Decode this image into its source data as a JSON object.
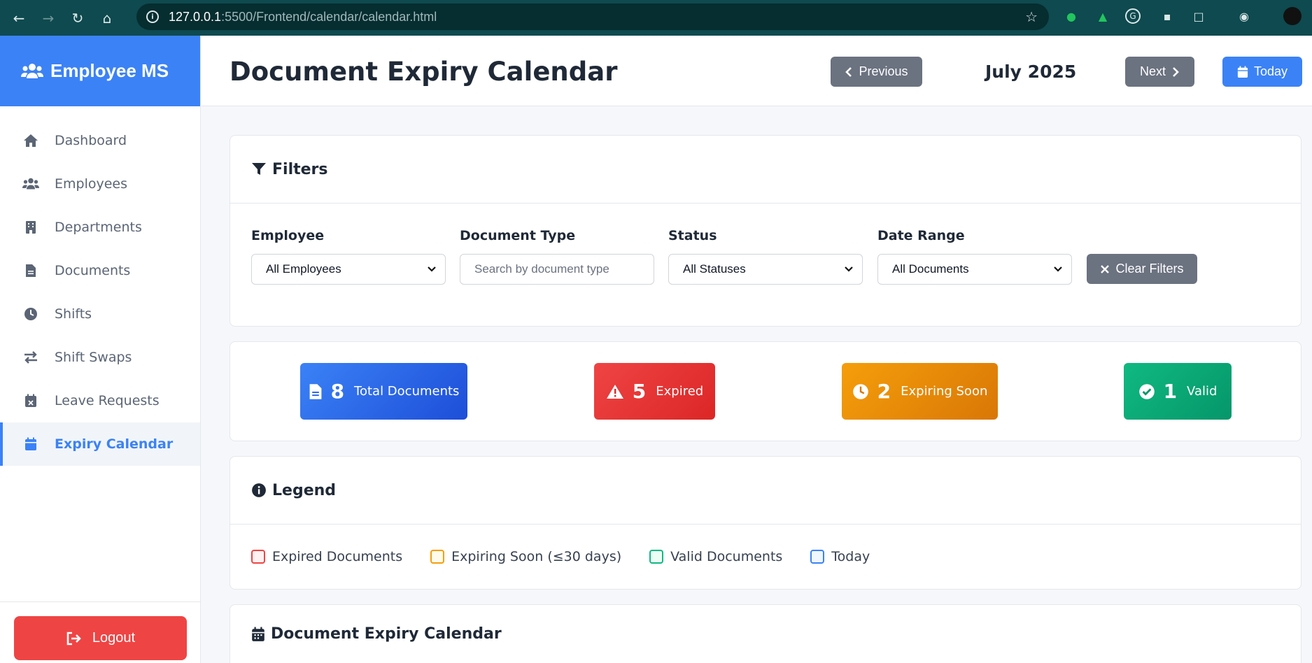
{
  "browser": {
    "url_host": "127.0.0.1",
    "url_rest": ":5500/Frontend/calendar/calendar.html"
  },
  "sidebar": {
    "brand": "Employee MS",
    "items": [
      {
        "label": "Dashboard",
        "icon": "home-icon"
      },
      {
        "label": "Employees",
        "icon": "users-icon"
      },
      {
        "label": "Departments",
        "icon": "building-icon"
      },
      {
        "label": "Documents",
        "icon": "file-icon"
      },
      {
        "label": "Shifts",
        "icon": "clock-icon"
      },
      {
        "label": "Shift Swaps",
        "icon": "swap-icon"
      },
      {
        "label": "Leave Requests",
        "icon": "calendar-x-icon"
      },
      {
        "label": "Expiry Calendar",
        "icon": "calendar-icon",
        "active": true
      }
    ],
    "logout_label": "Logout"
  },
  "header": {
    "title": "Document Expiry Calendar",
    "previous_label": "Previous",
    "month": "July 2025",
    "next_label": "Next",
    "today_label": "Today"
  },
  "filters": {
    "title": "Filters",
    "employee_label": "Employee",
    "employee_value": "All Employees",
    "doc_type_label": "Document Type",
    "doc_type_placeholder": "Search by document type",
    "status_label": "Status",
    "status_value": "All Statuses",
    "date_range_label": "Date Range",
    "date_range_value": "All Documents",
    "clear_label": "Clear Filters"
  },
  "stats": [
    {
      "value": "8",
      "label": "Total Documents",
      "color": "#2563eb"
    },
    {
      "value": "5",
      "label": "Expired",
      "color": "#dc2626"
    },
    {
      "value": "2",
      "label": "Expiring Soon",
      "color": "#d97706"
    },
    {
      "value": "1",
      "label": "Valid",
      "color": "#059669"
    }
  ],
  "legend": {
    "title": "Legend",
    "items": [
      {
        "label": "Expired Documents",
        "color": "#ef4444"
      },
      {
        "label": "Expiring Soon (≤30 days)",
        "color": "#f59e0b"
      },
      {
        "label": "Valid Documents",
        "color": "#10b981"
      },
      {
        "label": "Today",
        "color": "#3b82f6"
      }
    ]
  },
  "calendar": {
    "title": "Document Expiry Calendar"
  }
}
